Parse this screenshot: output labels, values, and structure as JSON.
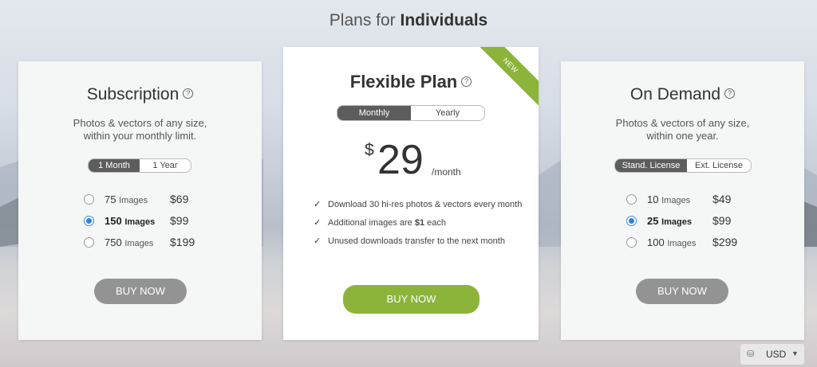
{
  "page": {
    "title_prefix": "Plans for",
    "title_strong": "Individuals"
  },
  "subscription": {
    "title": "Subscription",
    "help": "?",
    "desc_line1": "Photos & vectors of any size,",
    "desc_line2": "within your monthly limit.",
    "toggle": [
      "1 Month",
      "1 Year"
    ],
    "toggle_selected": "1 Month",
    "options": [
      {
        "qty": "75",
        "unit": "Images",
        "price": "$69",
        "selected": false
      },
      {
        "qty": "150",
        "unit": "Images",
        "price": "$99",
        "selected": true
      },
      {
        "qty": "750",
        "unit": "Images",
        "price": "$199",
        "selected": false
      }
    ],
    "button": "BUY NOW"
  },
  "flexible": {
    "title": "Flexible Plan",
    "help": "?",
    "ribbon": "NEW",
    "toggle": [
      "Monthly",
      "Yearly"
    ],
    "toggle_selected": "Monthly",
    "currency": "$",
    "amount": "29",
    "period": "/month",
    "features": [
      {
        "pre": "Download 30 hi-res photos & vectors every month",
        "strong": "",
        "post": ""
      },
      {
        "pre": "Additional images are ",
        "strong": "$1",
        "post": " each"
      },
      {
        "pre": "Unused downloads transfer to the next month",
        "strong": "",
        "post": ""
      }
    ],
    "button": "BUY NOW"
  },
  "ondemand": {
    "title": "On Demand",
    "help": "?",
    "desc_line1": "Photos & vectors of any size,",
    "desc_line2": "within one year.",
    "toggle": [
      "Stand. License",
      "Ext. License"
    ],
    "toggle_selected": "Stand. License",
    "options": [
      {
        "qty": "10",
        "unit": "Images",
        "price": "$49",
        "selected": false
      },
      {
        "qty": "25",
        "unit": "Images",
        "price": "$99",
        "selected": true
      },
      {
        "qty": "100",
        "unit": "Images",
        "price": "$299",
        "selected": false
      }
    ],
    "button": "BUY NOW"
  },
  "currency_selector": {
    "value": "USD",
    "icon": "coins-icon"
  },
  "colors": {
    "accent_green": "#8cb43a",
    "radio_blue": "#2f80e0",
    "toggle_dark": "#5d5d5d",
    "button_gray": "#939393"
  }
}
